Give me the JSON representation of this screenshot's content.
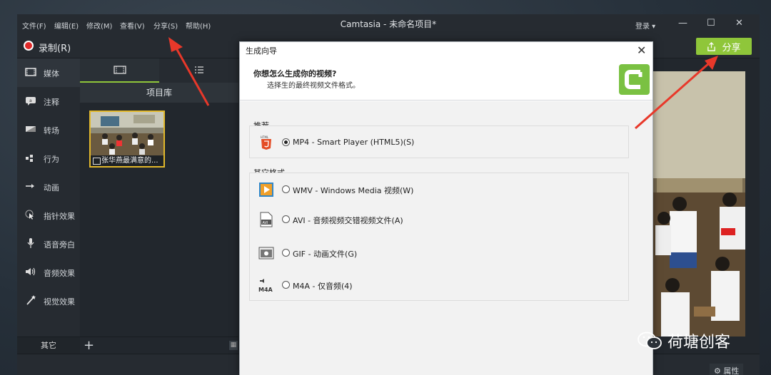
{
  "window": {
    "title": "Camtasia - 未命名项目*",
    "menus": [
      "文件(F)",
      "编辑(E)",
      "修改(M)",
      "查看(V)",
      "分享(S)",
      "帮助(H)"
    ],
    "login": "登录 ▾",
    "controls": {
      "minimize": "—",
      "maximize": "☐",
      "close": "✕"
    }
  },
  "toolbar": {
    "record_label": "录制(R)",
    "share_label": "分享"
  },
  "sidebar": {
    "items": [
      {
        "label": "媒体",
        "icon": "media-icon"
      },
      {
        "label": "注释",
        "icon": "annotation-icon"
      },
      {
        "label": "转场",
        "icon": "transition-icon"
      },
      {
        "label": "行为",
        "icon": "behavior-icon"
      },
      {
        "label": "动画",
        "icon": "animation-icon"
      },
      {
        "label": "指针效果",
        "icon": "cursor-effect-icon"
      },
      {
        "label": "语音旁白",
        "icon": "microphone-icon"
      },
      {
        "label": "音频效果",
        "icon": "speaker-icon"
      },
      {
        "label": "视觉效果",
        "icon": "magic-wand-icon"
      }
    ],
    "other_label": "其它"
  },
  "library": {
    "title": "项目库",
    "clip_caption": "张华燕最满意的..."
  },
  "dialog": {
    "title": "生成向导",
    "question": "你想怎么生成你的视频?",
    "subtitle": "选择生的最终视频文件格式。",
    "recommended_label": "推荐",
    "other_label": "其它格式",
    "recommended": [
      {
        "label": "MP4 - Smart Player (HTML5)(S)",
        "icon": "html5-icon",
        "selected": true
      }
    ],
    "others": [
      {
        "label": "WMV - Windows Media 视频(W)",
        "icon": "wmv-icon",
        "selected": false
      },
      {
        "label": "AVI - 音频视频交错视频文件(A)",
        "icon": "avi-icon",
        "selected": false
      },
      {
        "label": "GIF - 动画文件(G)",
        "icon": "gif-icon",
        "selected": false
      },
      {
        "label": "M4A - 仅音频(4)",
        "icon": "m4a-icon",
        "selected": false
      }
    ]
  },
  "properties_label": "属性",
  "watermark": "荷塘创客",
  "colors": {
    "accent": "#8fc63a",
    "record": "#e02a2a",
    "arrow": "#e8382a",
    "highlight": "#e2b82b"
  }
}
